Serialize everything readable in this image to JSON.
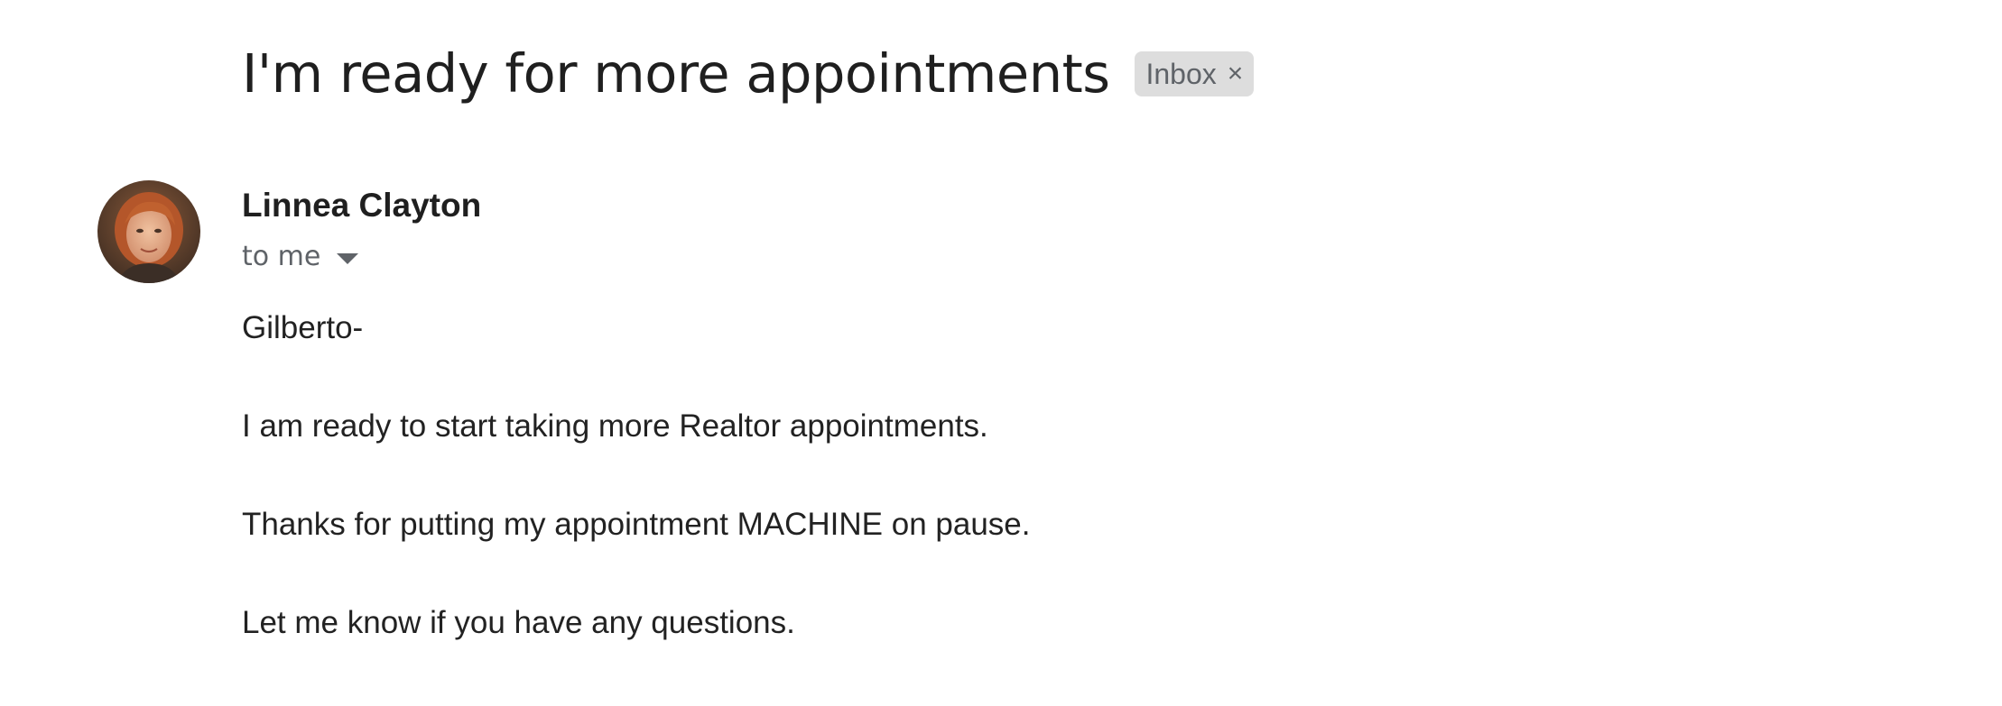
{
  "email": {
    "subject": "I'm ready for more appointments",
    "label": {
      "text": "Inbox",
      "close_glyph": "×"
    },
    "sender": {
      "name": "Linnea Clayton",
      "avatar_icon": "sender-avatar-photo"
    },
    "recipient": {
      "text": "to me",
      "expand_icon": "caret-down-icon"
    },
    "body": [
      "Gilberto-",
      "I am ready to start taking more Realtor appointments.",
      "Thanks for putting my appointment MACHINE on pause.",
      "Let me know if you have any questions."
    ]
  },
  "colors": {
    "subject_text": "#1f1f1f",
    "chip_background": "#dddddd",
    "chip_text": "#5f6368",
    "secondary_text": "#5f6368",
    "body_text": "#222222"
  }
}
